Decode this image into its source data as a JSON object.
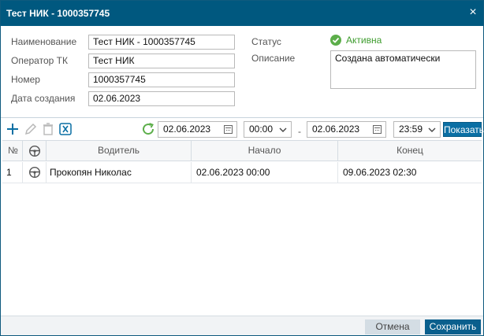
{
  "dialog": {
    "title": "Тест НИК - 1000357745",
    "close_glyph": "×"
  },
  "form": {
    "name_label": "Наименование",
    "name_value": "Тест НИК - 1000357745",
    "operator_label": "Оператор ТК",
    "operator_value": "Тест НИК",
    "number_label": "Номер",
    "number_value": "1000357745",
    "created_label": "Дата создания",
    "created_value": "02.06.2023",
    "status_label": "Статус",
    "status_value": "Активна",
    "description_label": "Описание",
    "description_value": "Создана автоматически"
  },
  "toolbar": {
    "icons": [
      "add-icon",
      "edit-icon",
      "delete-icon",
      "excel-export-icon",
      "refresh-icon"
    ],
    "date_from": "02.06.2023",
    "time_from": "00:00",
    "separator": "-",
    "date_to": "02.06.2023",
    "time_to": "23:59",
    "show_label": "Показать"
  },
  "grid": {
    "columns": [
      "№",
      "",
      "Водитель",
      "Начало",
      "Конец"
    ],
    "rows": [
      {
        "num": "1",
        "driver": "Прокопян Николас",
        "start": "02.06.2023 00:00",
        "end": "09.06.2023 02:30"
      }
    ]
  },
  "footer": {
    "cancel_label": "Отмена",
    "save_label": "Сохранить"
  },
  "colors": {
    "titlebar": "#00587f",
    "primary_button": "#0a5f8d",
    "status_green": "#5cae4a"
  }
}
